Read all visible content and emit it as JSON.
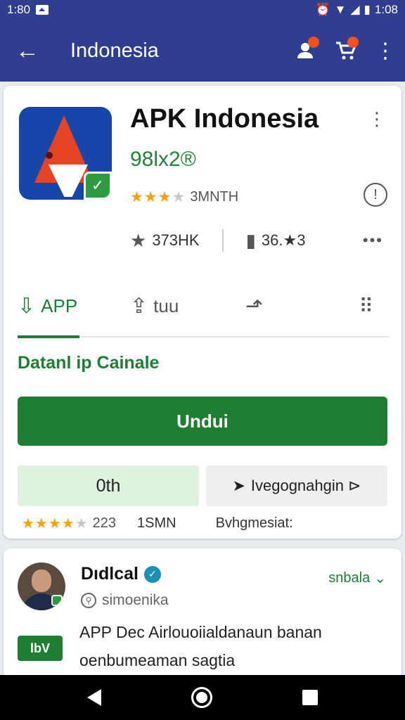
{
  "status_bar": {
    "time_left": "1:80",
    "time_right": "1:08",
    "icons": [
      "notification-icon",
      "alarm-icon",
      "wifi-icon",
      "signal-icon",
      "battery-icon"
    ]
  },
  "app_bar": {
    "title": "Indonesia",
    "icons": [
      "back-icon",
      "account-icon",
      "cart-icon",
      "more-icon"
    ]
  },
  "app": {
    "name": "APK Indonesia",
    "version": "98lx2®",
    "rating_count": "3MNTH",
    "stars": 3.5,
    "stat_rating": "373HK",
    "stat_reviews": "36.★3"
  },
  "tabs": [
    {
      "label": "APP",
      "active": true
    },
    {
      "label": "tuu",
      "active": false
    },
    {
      "label": "",
      "active": false
    }
  ],
  "section_title": "Datanl ip Cainale",
  "download_label": "Undui",
  "options": {
    "left": "0th",
    "right": "Ivegognahgin ⊳"
  },
  "meta": {
    "stars": 4.0,
    "count": "223",
    "size": "1SMN",
    "label": "Bvhgmesiat:"
  },
  "developer": {
    "name": "Dıdlcal",
    "handle": "simoenika",
    "follow_label": "snbala",
    "badge": "lbV",
    "desc_line1": "APP Dec Airlouoiialdanaun banan",
    "desc_line2": "oenbumeaman sagtia"
  },
  "colors": {
    "primary": "#2f3e8f",
    "accent": "#1e7e34",
    "star": "#f4a10b"
  }
}
